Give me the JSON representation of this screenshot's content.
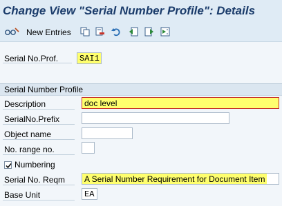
{
  "title": "Change View \"Serial Number Profile\": Details",
  "toolbar": {
    "new_entries_label": "New Entries",
    "icons": [
      "edit-glasses-icon",
      "copy-icon",
      "delete-icon",
      "undo-icon",
      "export-icon",
      "import-icon",
      "select-all-icon"
    ]
  },
  "header": {
    "serial_prof_label": "Serial No.Prof.",
    "serial_prof_value": "SAI1"
  },
  "group": {
    "title": "Serial Number Profile",
    "description_label": "Description",
    "description_value": "doc level",
    "prefix_label": "SerialNo.Prefix",
    "prefix_value": "",
    "object_name_label": "Object name",
    "object_name_value": "",
    "range_label": "No. range no.",
    "range_value": "",
    "numbering_label": "Numbering",
    "numbering_checked": true,
    "reqm_label": "Serial No. Reqm",
    "reqm_value": "A Serial Number Requirement for Document Item",
    "base_unit_label": "Base Unit",
    "base_unit_value": "EA"
  },
  "colors": {
    "highlight": "#ffff6e",
    "title": "#1b3c6b"
  }
}
